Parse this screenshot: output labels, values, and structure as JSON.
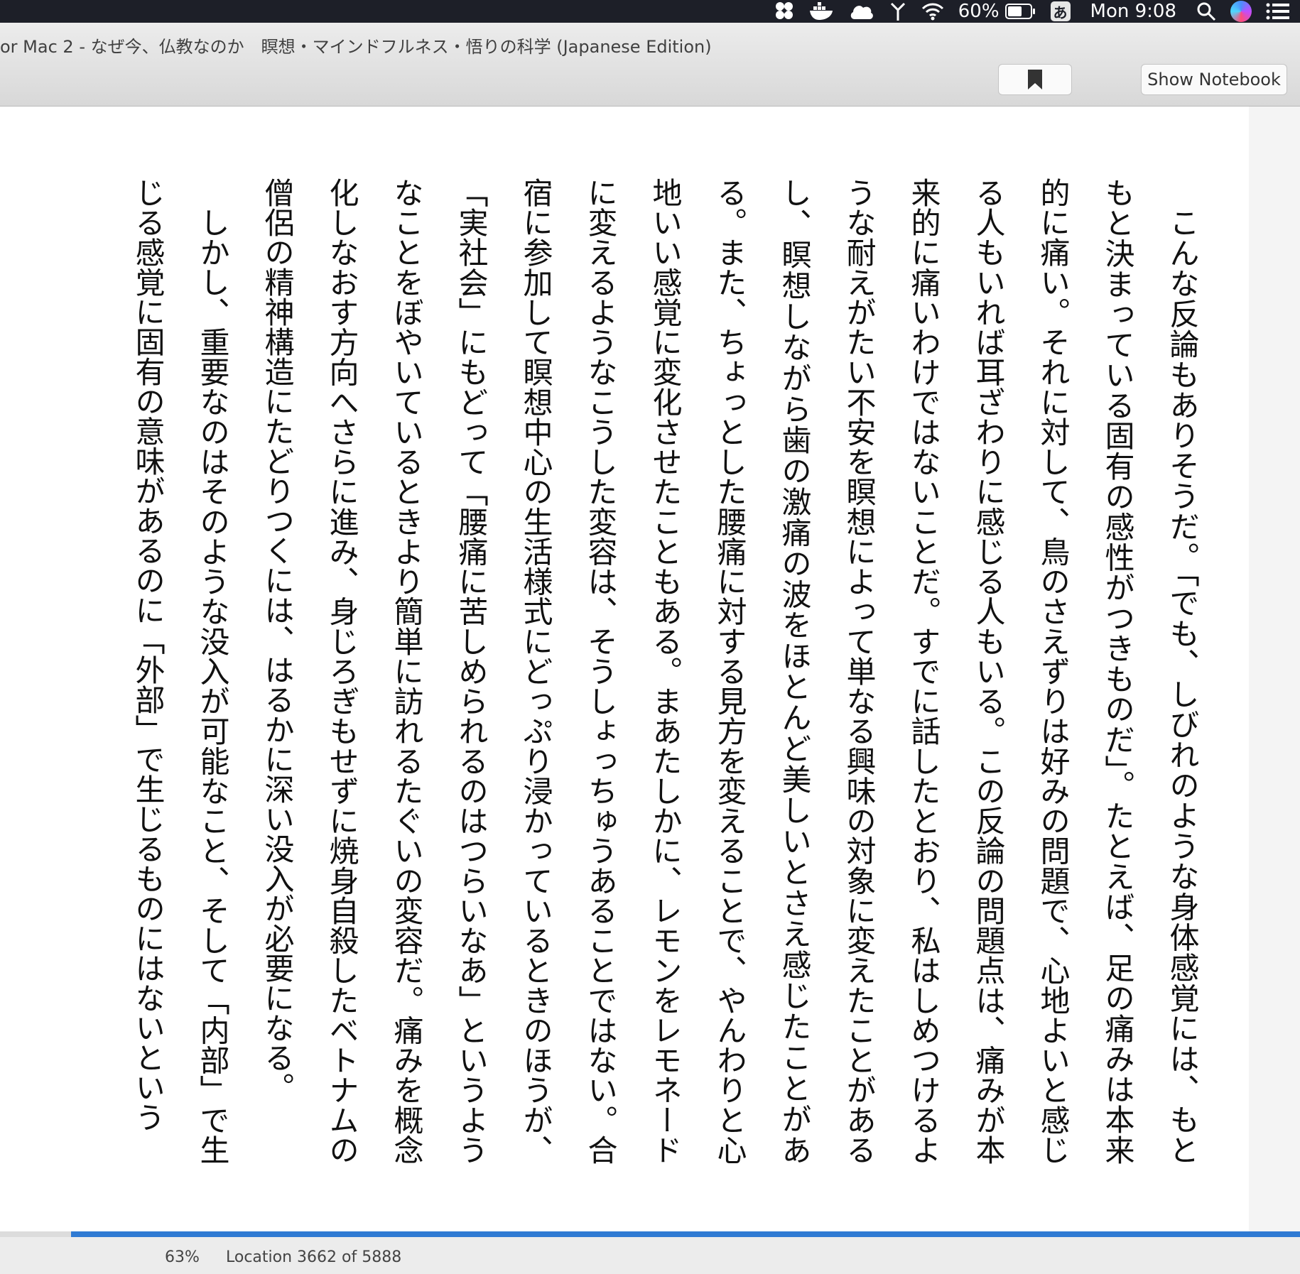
{
  "menubar": {
    "battery": "60%",
    "ime": "あ",
    "clock": "Mon 9:08"
  },
  "window": {
    "title": "or Mac 2 - なぜ今、仏教なのか　瞑想・マインドフルネス・悟りの科学 (Japanese Edition)",
    "show_notebook_label": "Show Notebook"
  },
  "book": {
    "paragraphs": [
      "こんな反論もありそうだ。「でも、しびれのような身体感覚には、もともと決まっている固有の感性がつきものだ」。たとえば、足の痛みは本来的に痛い。それに対して、鳥のさえずりは好みの問題で、心地よいと感じる人もいれば耳ざわりに感じる人もいる。この反論の問題点は、痛みが本来的に痛いわけではないことだ。すでに話したとおり、私はしめつけるような耐えがたい不安を瞑想によって単なる興味の対象に変えたことがあるし、瞑想しながら歯の激痛の波をほとんど美しいとさえ感じたことがある。また、ちょっとした腰痛に対する見方を変えることで、やんわりと心地いい感覚に変化させたこともある。まあたしかに、レモンをレモネードに変えるようなこうした変容は、そうしょっちゅうあることではない。合宿に参加して瞑想中心の生活様式にどっぷり浸かっているときのほうが、「実社会」にもどって「腰痛に苦しめられるのはつらいなあ」というようなことをぼやいているときより簡単に訪れるたぐいの変容だ。痛みを概念化しなおす方向へさらに進み、身じろぎもせずに焼身自殺したベトナムの僧侶の精神構造にたどりつくには、はるかに深い没入が必要になる。",
      "しかし、重要なのはそのような没入が可能なこと、そして「内部」で生じる感覚に固有の意味があるのに「外部」で生じるものにはないという"
    ]
  },
  "footer": {
    "percent": "63%",
    "location": "Location 3662 of 5888",
    "progress_fraction": 0.622
  }
}
